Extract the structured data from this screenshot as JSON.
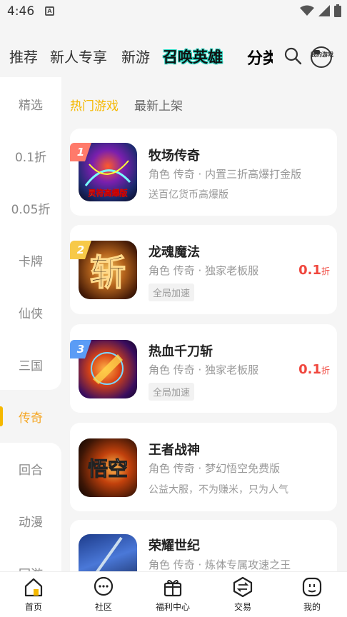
{
  "status_bar": {
    "time": "4:46",
    "notification_letter": "A"
  },
  "top_nav": {
    "tabs": [
      "推荐",
      "新人专享",
      "新游",
      "召唤英雄",
      "分类"
    ]
  },
  "side_menu": {
    "items": [
      "精选",
      "0.1折",
      "0.05折",
      "卡牌",
      "仙侠",
      "三国",
      "传奇",
      "回合",
      "动漫",
      "回游"
    ],
    "active_index": 6
  },
  "sub_tabs": [
    "热门游戏",
    "最新上架"
  ],
  "games": [
    {
      "rank": "1",
      "name": "牧场传奇",
      "meta": "角色 传奇 · 内置三折高爆打金版",
      "extra": "送百亿货币高爆版",
      "tag": "",
      "discount": "",
      "discount_unit": ""
    },
    {
      "rank": "2",
      "name": "龙魂魔法",
      "meta": "角色 传奇 · 独家老板服",
      "extra": "",
      "tag": "全局加速",
      "discount": "0.1",
      "discount_unit": "折"
    },
    {
      "rank": "3",
      "name": "热血千刀斩",
      "meta": "角色 传奇 · 独家老板服",
      "extra": "",
      "tag": "全局加速",
      "discount": "0.1",
      "discount_unit": "折"
    },
    {
      "rank": "",
      "name": "王者战神",
      "meta": "角色 传奇 · 梦幻悟空免费版",
      "extra": "公益大服，不为赚米，只为人气",
      "tag": "",
      "discount": "",
      "discount_unit": ""
    },
    {
      "rank": "",
      "name": "荣耀世纪",
      "meta": "角色 传奇 · 炼体专属攻速之王",
      "extra": "",
      "tag": "",
      "discount": "",
      "discount_unit": ""
    }
  ],
  "icon_art_text": {
    "game1": "灵符高爆版",
    "game2": "斩",
    "game4": "悟空"
  },
  "bottom_nav": [
    "首页",
    "社区",
    "福利中心",
    "交易",
    "我的"
  ],
  "mygames_label": "我的游戏",
  "colors": {
    "accent": "#f5b800",
    "discount": "#f0473e",
    "rank1": "#ff7a6b",
    "rank2": "#f7c948",
    "rank3": "#5b9cf5"
  }
}
